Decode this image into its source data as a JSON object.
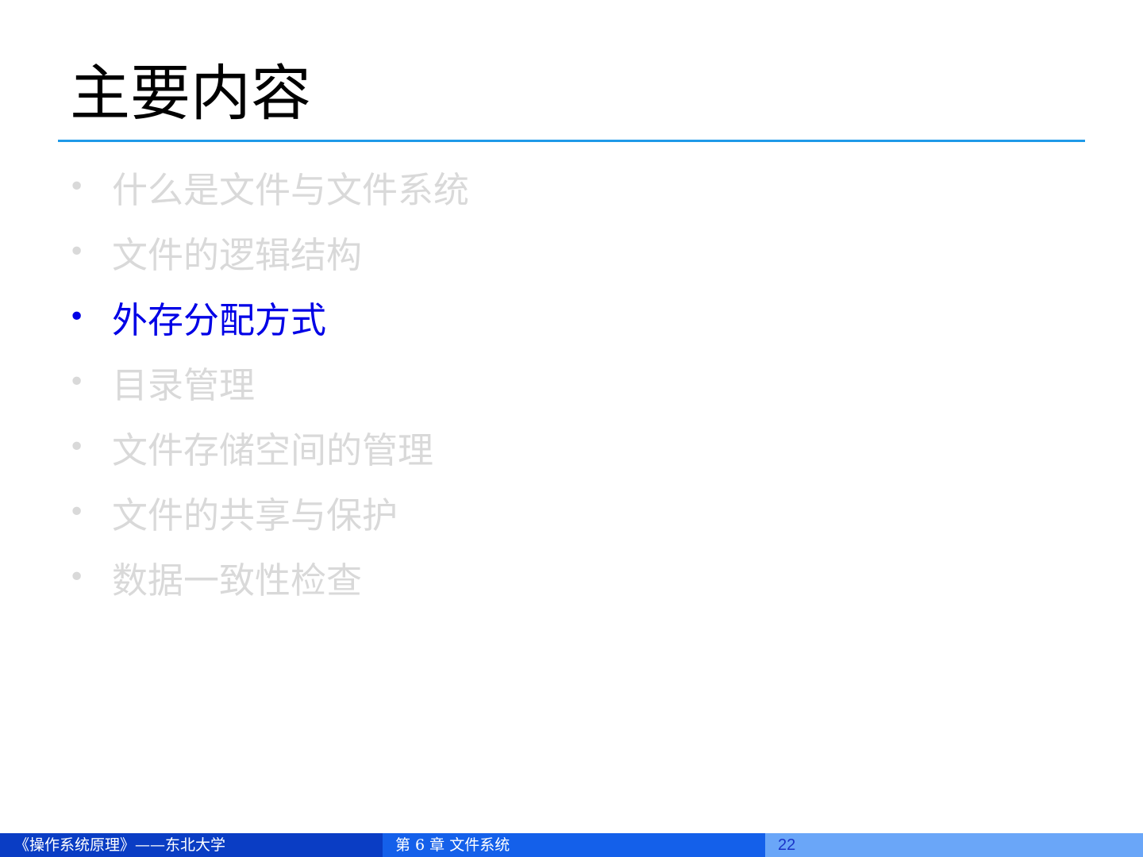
{
  "slide": {
    "title": "主要内容"
  },
  "agenda": {
    "bullet": "•",
    "items": [
      {
        "label": "什么是文件与文件系统",
        "active": false
      },
      {
        "label": "文件的逻辑结构",
        "active": false
      },
      {
        "label": "外存分配方式",
        "active": true
      },
      {
        "label": "目录管理",
        "active": false
      },
      {
        "label": "文件存储空间的管理",
        "active": false
      },
      {
        "label": "文件的共享与保护",
        "active": false
      },
      {
        "label": "数据一致性检查",
        "active": false
      }
    ]
  },
  "footer": {
    "course": "《操作系统原理》——东北大学",
    "chapter": "第 6 章  文件系统",
    "page_number": "22"
  },
  "colors": {
    "title_rule": "#1f9ae8",
    "active_item": "#0000e6",
    "inactive_item": "#d9d9d9",
    "footer_left": "#0a3dc4",
    "footer_mid": "#1460ea",
    "footer_right": "#6aa6f8"
  }
}
